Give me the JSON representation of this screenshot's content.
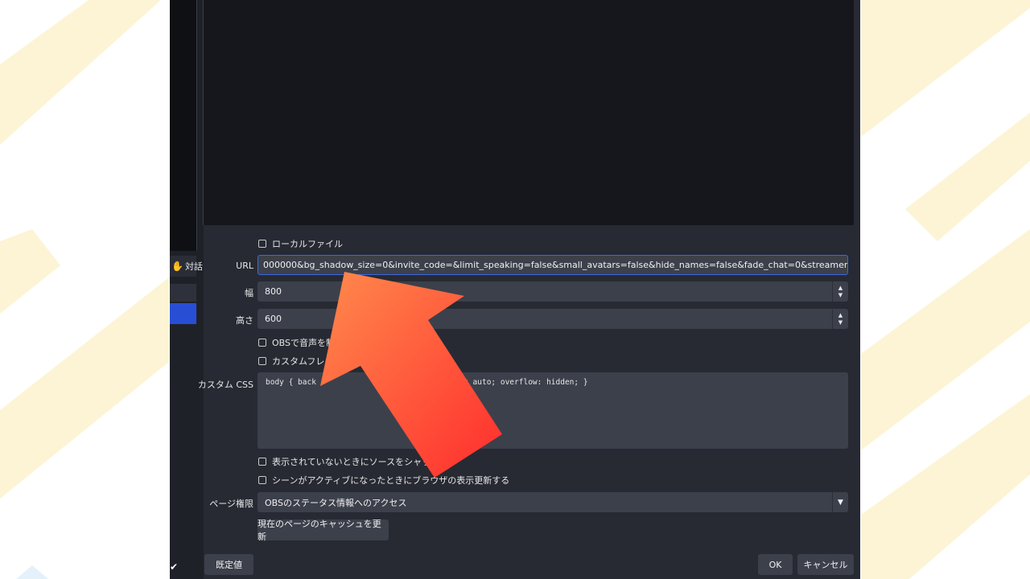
{
  "left_panel": {
    "toolbar_label": "対話",
    "hand_icon": "hand-icon"
  },
  "form": {
    "local_file_label": "ローカルファイル",
    "url_label": "URL",
    "url_value": "000000&bg_shadow_size=0&invite_code=&limit_speaking=false&small_avatars=false&hide_names=false&fade_chat=0&streamer_avatar_first=false",
    "width_label": "幅",
    "width_value": "800",
    "height_label": "高さ",
    "height_value": "600",
    "obs_audio_label": "OBSで音声を制",
    "custom_frame_label": "カスタムフレーム",
    "custom_css_label": "カスタム CSS",
    "custom_css_part1": "body { back",
    "custom_css_part2": "margin: 0px auto; overflow: hidden; }",
    "shutdown_label": "表示されていないときにソースをシャットダウ",
    "refresh_label_part1": "シーンがアクティブになったときにブラウザの表示",
    "refresh_label_part2": "更新する",
    "page_perm_label": "ページ権限",
    "page_perm_value": "OBSのステータス情報へのアクセス",
    "refresh_cache_button": "現在のページのキャッシュを更新"
  },
  "footer": {
    "defaults_button": "既定値",
    "ok_button": "OK",
    "cancel_button": "キャンセル"
  },
  "colors": {
    "accent": "#3b68e0",
    "arrow_start": "#ff8a4c",
    "arrow_end": "#ff2d2d"
  }
}
